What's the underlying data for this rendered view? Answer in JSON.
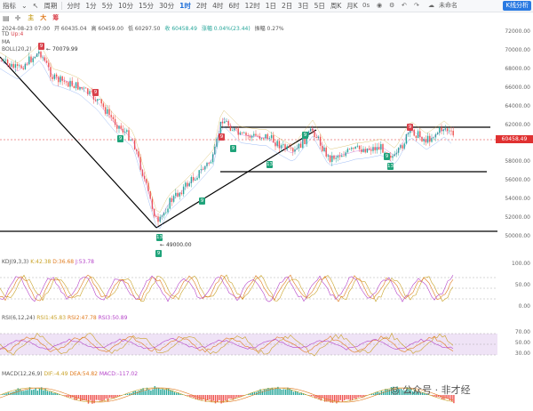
{
  "toolbar": {
    "left": [
      "指标",
      "分时",
      "1分",
      "5分",
      "10分",
      "15分",
      "30分",
      "1时",
      "2时",
      "4时",
      "6时",
      "12时",
      "1日",
      "2日",
      "3日",
      "5日",
      "周K",
      "月K"
    ],
    "active": "1时",
    "right_time": "0s",
    "status": "未命名",
    "kline_button": "K线分析"
  },
  "chips": [
    "主",
    "大",
    "筹"
  ],
  "info": {
    "date": "2024-08-23 07:00",
    "open": "开 60435.04",
    "high": "高 60459.00",
    "low": "低 60297.50",
    "close": "收 60458.49",
    "change": "涨幅 0.04%(23.44)",
    "amplitude": "振幅 0.27%"
  },
  "indicators": {
    "td": "TD",
    "td_val": "Up:4",
    "ma": "MA",
    "boll": "BOLL(20,2)",
    "kdj": "KDJ(9,3,3)",
    "kdj_k": "K:42.38",
    "kdj_d": "D:36.68",
    "kdj_j": "J:53.78",
    "rsi": "RSI(6,12,24)",
    "rsi1": "RSI1:45.83",
    "rsi2": "RSI2:47.78",
    "rsi3": "RSI3:50.89",
    "macd": "MACD(12,26,9)",
    "dif": "DIF:-4.49",
    "dea": "DEA:54.82",
    "macd_val": "MACD:-117.02"
  },
  "price_axis": [
    "72000.00",
    "70000.00",
    "68000.00",
    "66000.00",
    "64000.00",
    "62000.00",
    "58000.00",
    "56000.00",
    "54000.00",
    "52000.00",
    "50000.00"
  ],
  "current_price": "60458.49",
  "labels": {
    "high_mark": "70079.99",
    "low_mark": "49000.00"
  },
  "kdj_axis": [
    "100.00",
    "50.00",
    "0.00"
  ],
  "rsi_axis": [
    "70.00",
    "50.00",
    "30.00"
  ],
  "td_badges": [
    "9",
    "9",
    "9",
    "9",
    "9",
    "9",
    "9",
    "13",
    "13",
    "13",
    "9",
    "9",
    "9"
  ],
  "watermark": "公众号 · 非才经",
  "colors": {
    "up": "#26a69a",
    "down": "#ef5350",
    "accent": "#2a7ae2",
    "price": "#e03131"
  }
}
